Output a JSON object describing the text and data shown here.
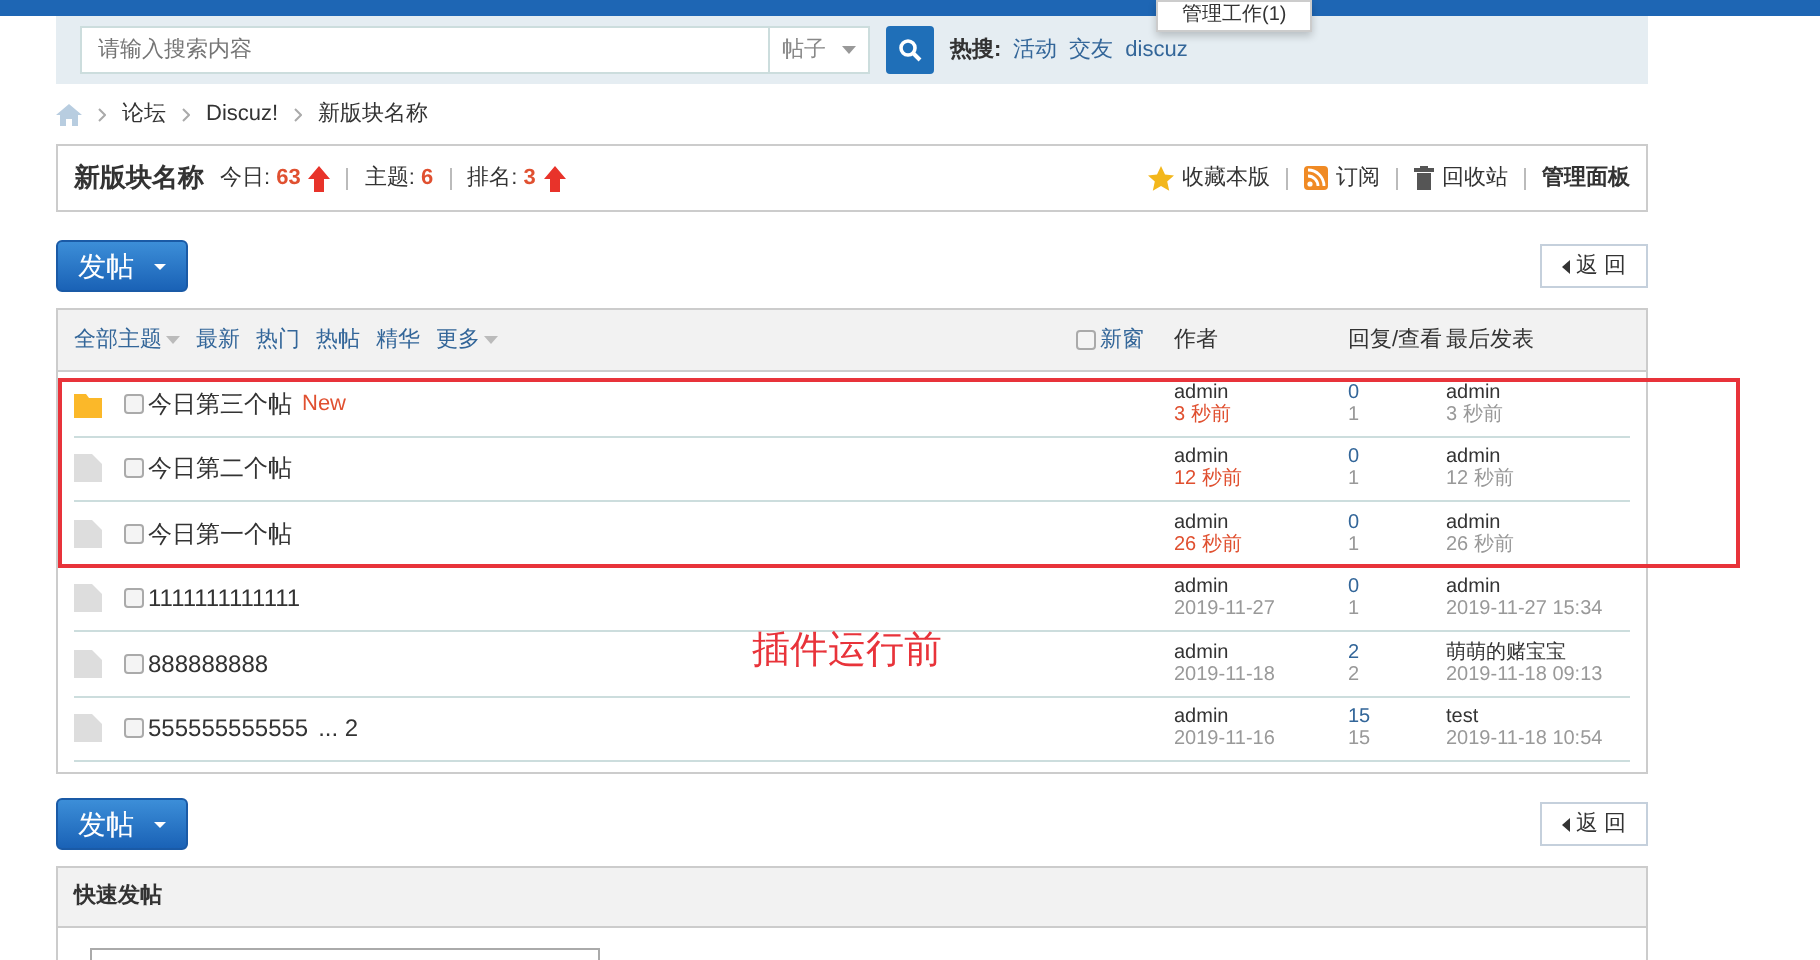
{
  "header": {
    "menu_popup": "管理工作(1)"
  },
  "search": {
    "placeholder": "请输入搜索内容",
    "type_select": "帖子",
    "hot_label": "热搜:",
    "hot_links": [
      "活动",
      "交友",
      "discuz"
    ]
  },
  "breadcrumb": [
    "论坛",
    "Discuz!",
    "新版块名称"
  ],
  "forum": {
    "name": "新版块名称",
    "stats": [
      {
        "label": "今日:",
        "value": "63",
        "rising": true
      },
      {
        "label": "主题:",
        "value": "6",
        "rising": false
      },
      {
        "label": "排名:",
        "value": "3",
        "rising": true
      }
    ],
    "actions": [
      {
        "label": "收藏本版",
        "kind": "star"
      },
      {
        "label": "订阅",
        "kind": "rss"
      },
      {
        "label": "回收站",
        "kind": "trash"
      },
      {
        "label": "管理面板",
        "kind": "plain"
      }
    ]
  },
  "top_buttons": {
    "post_button": "发帖",
    "back_button": "返 回"
  },
  "bottom_buttons": {
    "post_button": "发帖",
    "back_button": "返 回"
  },
  "filters": [
    {
      "label": "全部主题",
      "dropdown": true
    },
    {
      "label": "最新",
      "dropdown": false
    },
    {
      "label": "热门",
      "dropdown": false
    },
    {
      "label": "热帖",
      "dropdown": false
    },
    {
      "label": "精华",
      "dropdown": false
    },
    {
      "label": "更多",
      "dropdown": true
    }
  ],
  "new_window": {
    "label": "新窗",
    "checked": false
  },
  "columns": [
    "作者",
    "回复/查看",
    "最后发表"
  ],
  "annotation": {
    "label": "插件运行前",
    "framed_threads": [
      {
        "checked": false,
        "title": "今日第三个帖",
        "new_label": "New",
        "unread": true,
        "author": "admin",
        "post_time": "3 秒前",
        "recent": true,
        "replies": "0",
        "views": "1",
        "last_poster": "admin",
        "last_time": "3 秒前"
      },
      {
        "checked": false,
        "title": "今日第二个帖",
        "unread": false,
        "author": "admin",
        "post_time": "12 秒前",
        "recent": true,
        "replies": "0",
        "views": "1",
        "last_poster": "admin",
        "last_time": "12 秒前"
      },
      {
        "checked": false,
        "title": "今日第一个帖",
        "unread": false,
        "author": "admin",
        "post_time": "26 秒前",
        "recent": true,
        "replies": "0",
        "views": "1",
        "last_poster": "admin",
        "last_time": "26 秒前"
      }
    ]
  },
  "threads": [
    {
      "checked": false,
      "title": "1111111111111",
      "unread": false,
      "author": "admin",
      "post_time": "2019-11-27",
      "recent": false,
      "replies": "0",
      "views": "1",
      "last_poster": "admin",
      "last_time": "2019-11-27 15:34"
    },
    {
      "checked": false,
      "title": "888888888",
      "unread": false,
      "author": "admin",
      "post_time": "2019-11-18",
      "recent": false,
      "replies": "2",
      "views": "2",
      "last_poster": "萌萌的赌宝宝",
      "last_time": "2019-11-18 09:13"
    },
    {
      "checked": false,
      "title": "555555555555",
      "pages": "... 2",
      "unread": false,
      "author": "admin",
      "post_time": "2019-11-16",
      "recent": false,
      "replies": "15",
      "views": "15",
      "last_poster": "test",
      "last_time": "2019-11-18 10:54"
    }
  ],
  "quick_post": {
    "title": "快速发帖"
  }
}
